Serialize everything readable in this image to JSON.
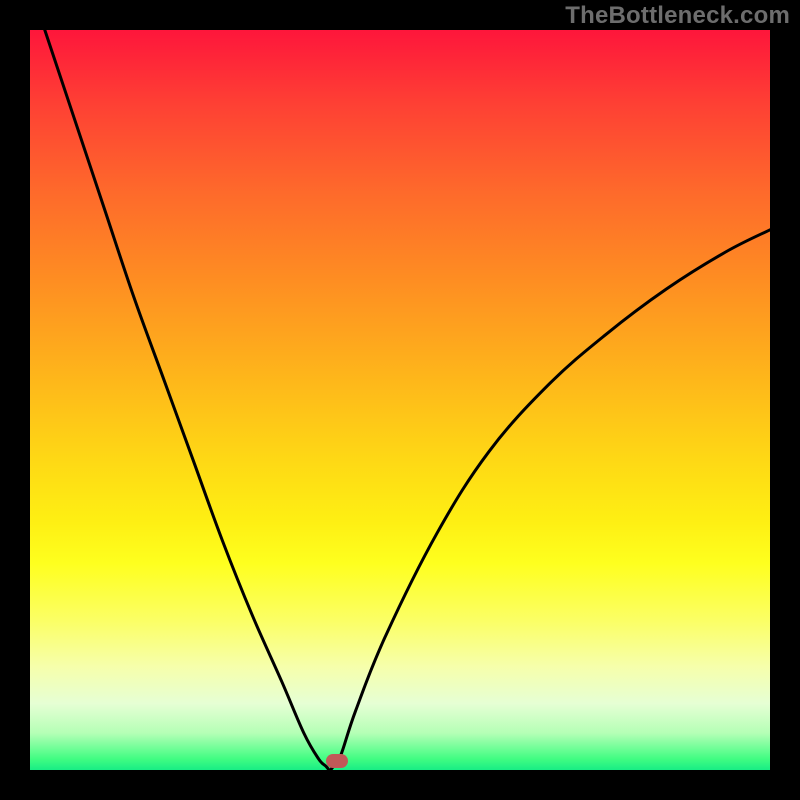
{
  "watermark": "TheBottleneck.com",
  "chart_data": {
    "type": "line",
    "title": "",
    "xlabel": "",
    "ylabel": "",
    "xlim": [
      0,
      100
    ],
    "ylim": [
      0,
      100
    ],
    "grid": false,
    "legend": false,
    "series": [
      {
        "name": "bottleneck-curve",
        "x": [
          2,
          6,
          10,
          14,
          18,
          22,
          26,
          30,
          34,
          37,
          39,
          40,
          40.5,
          41,
          42,
          44,
          48,
          55,
          62,
          70,
          78,
          86,
          94,
          100
        ],
        "y": [
          100,
          88,
          76,
          64,
          53,
          42,
          31,
          21,
          12,
          5,
          1.5,
          0.5,
          0,
          0.5,
          2,
          8,
          18,
          32,
          43,
          52,
          59,
          65,
          70,
          73
        ]
      }
    ],
    "marker": {
      "x": 41.5,
      "y": 1.2,
      "label": "optimal-point"
    },
    "annotations": []
  },
  "colors": {
    "curve": "#000000",
    "marker": "#c15958",
    "frame": "#000000"
  }
}
